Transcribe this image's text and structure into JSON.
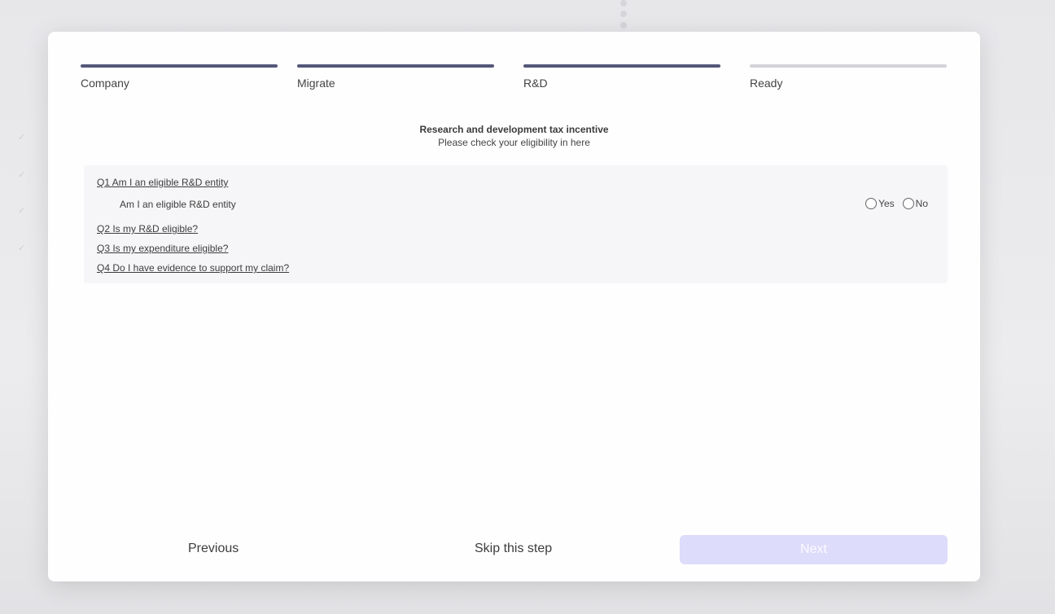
{
  "wizard": {
    "steps": [
      {
        "label": "Company",
        "status": "complete"
      },
      {
        "label": "Migrate",
        "status": "complete"
      },
      {
        "label": "R&D",
        "status": "complete"
      },
      {
        "label": "Ready",
        "status": "pending"
      }
    ],
    "accent_color": "#54577a",
    "pending_color": "#d3d3d9"
  },
  "section": {
    "title": "Research and development tax incentive",
    "subtitle": "Please check your eligibility in here"
  },
  "questions": [
    {
      "label": "Q1 Am I an eligible R&D entity",
      "expanded": true,
      "sub_question": "Am I an eligible R&D entity",
      "options": [
        "Yes",
        "No"
      ],
      "selected": null
    },
    {
      "label": "Q2 Is my R&D eligible?",
      "expanded": false
    },
    {
      "label": "Q3 Is my expenditure eligible?",
      "expanded": false
    },
    {
      "label": "Q4 Do I have evidence to support my claim?",
      "expanded": false
    }
  ],
  "footer": {
    "previous_label": "Previous",
    "skip_label": "Skip this step",
    "next_label": "Next",
    "next_disabled": true,
    "next_color": "#dedcfb"
  }
}
